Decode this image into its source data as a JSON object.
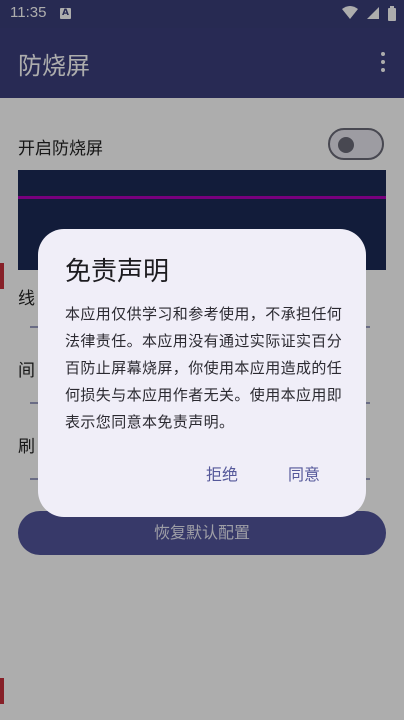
{
  "status_bar": {
    "time": "11:35",
    "notification_icon": "A",
    "icons": [
      "wifi-icon",
      "signal-icon",
      "battery-icon"
    ]
  },
  "app_bar": {
    "title": "防烧屏",
    "menu_icon": "overflow-menu-icon"
  },
  "settings": {
    "toggle_label": "开启防烧屏",
    "toggle_on": false,
    "slider_labels": [
      "线",
      "间",
      "刷"
    ],
    "reset_button": "恢复默认配置"
  },
  "dialog": {
    "title": "免责声明",
    "body": "本应用仅供学习和参考使用，不承担任何法律责任。本应用没有通过实际证实百分百防止屏幕烧屏，你使用本应用造成的任何损失与本应用作者无关。使用本应用即表示您同意本免责声明。",
    "decline": "拒绝",
    "agree": "同意"
  },
  "colors": {
    "primary": "#3b3e7c",
    "dialog_bg": "#f0eef8",
    "accent_text": "#55589a",
    "preview_line": "#b000b8"
  }
}
